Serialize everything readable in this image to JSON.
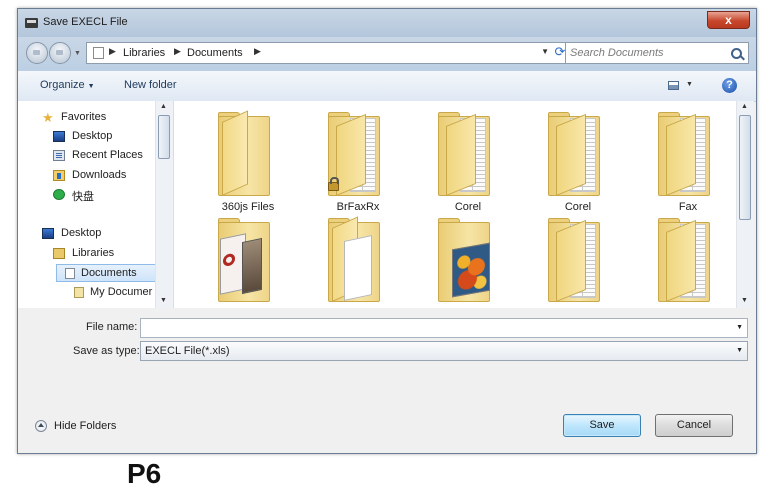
{
  "window": {
    "title": "Save EXECL File",
    "close_label": "x"
  },
  "address": {
    "path": [
      "Libraries",
      "Documents"
    ],
    "search_placeholder": "Search Documents"
  },
  "toolbar": {
    "organize": "Organize",
    "new_folder": "New folder",
    "help": "?"
  },
  "nav": {
    "favorites": "Favorites",
    "desktop": "Desktop",
    "recent_places": "Recent Places",
    "downloads": "Downloads",
    "kuaipan": "快盘",
    "desktop2": "Desktop",
    "libraries": "Libraries",
    "documents": "Documents",
    "my_documents": "My Documer"
  },
  "files": [
    {
      "label": "360js Files",
      "icon": "folder-icon"
    },
    {
      "label": "BrFaxRx",
      "icon": "locked-folder-icon"
    },
    {
      "label": "Corel",
      "icon": "folder-icon"
    },
    {
      "label": "Corel",
      "icon": "folder-icon"
    },
    {
      "label": "Fax",
      "icon": "folder-icon"
    },
    {
      "label": "",
      "icon": "folder-with-pictures-icon"
    },
    {
      "label": "",
      "icon": "folder-with-documents-icon"
    },
    {
      "label": "",
      "icon": "folder-with-photo-icon"
    },
    {
      "label": "",
      "icon": "folder-icon"
    },
    {
      "label": "",
      "icon": "folder-icon"
    }
  ],
  "form": {
    "file_name_label": "File name:",
    "file_name_value": "",
    "save_as_type_label": "Save as type:",
    "save_as_type_value": "EXECL File(*.xls)"
  },
  "footer": {
    "hide_folders": "Hide Folders",
    "save": "Save",
    "cancel": "Cancel"
  },
  "caption": "P6",
  "colors": {
    "accent": "#3c7fb1",
    "close": "#c8472c",
    "folder": "#f0d67f"
  }
}
